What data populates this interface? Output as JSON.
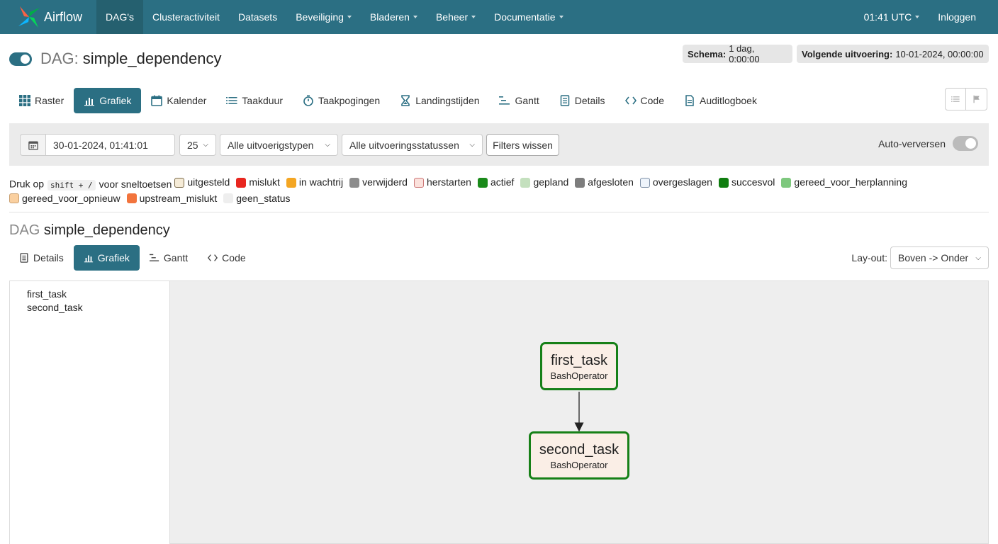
{
  "navbar": {
    "brand": "Airflow",
    "items": [
      {
        "label": "DAG's",
        "active": true,
        "dropdown": false
      },
      {
        "label": "Clusteractiviteit",
        "dropdown": false
      },
      {
        "label": "Datasets",
        "dropdown": false
      },
      {
        "label": "Beveiliging",
        "dropdown": true
      },
      {
        "label": "Bladeren",
        "dropdown": true
      },
      {
        "label": "Beheer",
        "dropdown": true
      },
      {
        "label": "Documentatie",
        "dropdown": true
      }
    ],
    "time": "01:41 UTC",
    "login": "Inloggen",
    "color": "#2b6f83"
  },
  "header": {
    "prefix": "DAG:",
    "dag_id": "simple_dependency",
    "schema_label": "Schema:",
    "schema_value": "1 dag, 0:00:00",
    "next_run_label": "Volgende uitvoering:",
    "next_run_value": "10-01-2024, 00:00:00"
  },
  "tabs": [
    {
      "label": "Raster",
      "icon": "grid-icon"
    },
    {
      "label": "Grafiek",
      "icon": "bar-chart-icon",
      "active": true
    },
    {
      "label": "Kalender",
      "icon": "calendar-icon"
    },
    {
      "label": "Taakduur",
      "icon": "list-icon"
    },
    {
      "label": "Taakpogingen",
      "icon": "stopwatch-icon"
    },
    {
      "label": "Landingstijden",
      "icon": "hourglass-icon"
    },
    {
      "label": "Gantt",
      "icon": "gantt-icon"
    },
    {
      "label": "Details",
      "icon": "document-icon"
    },
    {
      "label": "Code",
      "icon": "code-icon"
    },
    {
      "label": "Auditlogboek",
      "icon": "file-icon"
    }
  ],
  "filters": {
    "date": "30-01-2024, 01:41:01",
    "num_runs": "25",
    "run_type": "Alle uitvoerigstypen",
    "run_state": "Alle uitvoeringsstatussen",
    "clear_label": "Filters wissen",
    "auto_refresh_label": "Auto-verversen"
  },
  "legend": {
    "intro_prefix": "Druk op",
    "shortcut": "shift + /",
    "intro_suffix": "voor sneltoetsen",
    "states": [
      {
        "label": "uitgesteld",
        "color": "#f5ebd7",
        "border": "#7a6a4a"
      },
      {
        "label": "mislukt",
        "color": "#e8261f"
      },
      {
        "label": "in wachtrij",
        "color": "#f4a623"
      },
      {
        "label": "verwijderd",
        "color": "#8c8c8c"
      },
      {
        "label": "herstarten",
        "color": "#fbe1dc",
        "border": "#c77"
      },
      {
        "label": "actief",
        "color": "#1a8a1a"
      },
      {
        "label": "gepland",
        "color": "#c4e0be"
      },
      {
        "label": "afgesloten",
        "color": "#7d7d7d"
      },
      {
        "label": "overgeslagen",
        "color": "#eef4fb",
        "border": "#7d8fa6"
      },
      {
        "label": "succesvol",
        "color": "#0f7d0f"
      },
      {
        "label": "gereed_voor_herplanning",
        "color": "#7ec87e"
      },
      {
        "label": "gereed_voor_opnieuw",
        "color": "#fad0a0",
        "border": "#caa070"
      },
      {
        "label": "upstream_mislukt",
        "color": "#f2743d"
      },
      {
        "label": "geen_status",
        "color": "#eeeeee"
      }
    ]
  },
  "section": {
    "prefix": "DAG",
    "dag_id": "simple_dependency",
    "subtabs": [
      {
        "label": "Details",
        "icon": "document-icon"
      },
      {
        "label": "Grafiek",
        "icon": "bar-chart-icon",
        "active": true
      },
      {
        "label": "Gantt",
        "icon": "gantt-icon"
      },
      {
        "label": "Code",
        "icon": "code-icon"
      }
    ],
    "layout_label": "Lay-out:",
    "layout_value": "Boven -> Onder"
  },
  "graph": {
    "task_list": [
      "first_task",
      "second_task"
    ],
    "nodes": [
      {
        "id": "first_task",
        "operator": "BashOperator"
      },
      {
        "id": "second_task",
        "operator": "BashOperator"
      }
    ],
    "edges": [
      [
        "first_task",
        "second_task"
      ]
    ],
    "node_border_color": "#178017",
    "node_fill_color": "#faeee6"
  }
}
